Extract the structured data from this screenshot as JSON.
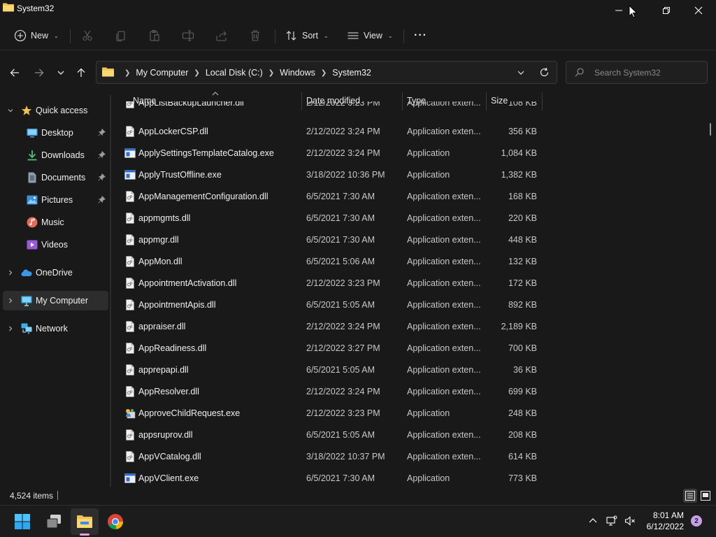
{
  "window": {
    "title": "System32"
  },
  "commandbar": {
    "new_label": "New",
    "sort_label": "Sort",
    "view_label": "View",
    "more_label": "···"
  },
  "address": {
    "crumbs": [
      "My Computer",
      "Local Disk (C:)",
      "Windows",
      "System32"
    ]
  },
  "search": {
    "placeholder": "Search System32"
  },
  "sidebar": {
    "items": [
      {
        "label": "Quick access",
        "icon": "star-icon"
      },
      {
        "label": "Desktop",
        "icon": "desktop-icon",
        "pinned": true
      },
      {
        "label": "Downloads",
        "icon": "download-icon",
        "pinned": true
      },
      {
        "label": "Documents",
        "icon": "document-icon",
        "pinned": true
      },
      {
        "label": "Pictures",
        "icon": "pictures-icon",
        "pinned": true
      },
      {
        "label": "Music",
        "icon": "music-icon"
      },
      {
        "label": "Videos",
        "icon": "video-icon"
      },
      {
        "label": "OneDrive",
        "icon": "cloud-icon"
      },
      {
        "label": "My Computer",
        "icon": "computer-icon",
        "selected": true
      },
      {
        "label": "Network",
        "icon": "network-icon"
      }
    ]
  },
  "filelist": {
    "columns": {
      "name": "Name",
      "date": "Date modified",
      "type": "Type",
      "size": "Size"
    },
    "partial_row": {
      "name": "AppListBackupLauncher.dll",
      "date": "2/12/2022 3:23 PM",
      "type": "Application exten...",
      "size": "108 KB"
    },
    "rows": [
      {
        "name": "AppLockerCSP.dll",
        "date": "2/12/2022 3:24 PM",
        "type": "Application exten...",
        "size": "356 KB",
        "kind": "dll"
      },
      {
        "name": "ApplySettingsTemplateCatalog.exe",
        "date": "2/12/2022 3:24 PM",
        "type": "Application",
        "size": "1,084 KB",
        "kind": "exe"
      },
      {
        "name": "ApplyTrustOffline.exe",
        "date": "3/18/2022 10:36 PM",
        "type": "Application",
        "size": "1,382 KB",
        "kind": "exe"
      },
      {
        "name": "AppManagementConfiguration.dll",
        "date": "6/5/2021 7:30 AM",
        "type": "Application exten...",
        "size": "168 KB",
        "kind": "dll"
      },
      {
        "name": "appmgmts.dll",
        "date": "6/5/2021 7:30 AM",
        "type": "Application exten...",
        "size": "220 KB",
        "kind": "dll"
      },
      {
        "name": "appmgr.dll",
        "date": "6/5/2021 7:30 AM",
        "type": "Application exten...",
        "size": "448 KB",
        "kind": "dll"
      },
      {
        "name": "AppMon.dll",
        "date": "6/5/2021 5:06 AM",
        "type": "Application exten...",
        "size": "132 KB",
        "kind": "dll"
      },
      {
        "name": "AppointmentActivation.dll",
        "date": "2/12/2022 3:23 PM",
        "type": "Application exten...",
        "size": "172 KB",
        "kind": "dll"
      },
      {
        "name": "AppointmentApis.dll",
        "date": "6/5/2021 5:05 AM",
        "type": "Application exten...",
        "size": "892 KB",
        "kind": "dll"
      },
      {
        "name": "appraiser.dll",
        "date": "2/12/2022 3:24 PM",
        "type": "Application exten...",
        "size": "2,189 KB",
        "kind": "dll"
      },
      {
        "name": "AppReadiness.dll",
        "date": "2/12/2022 3:27 PM",
        "type": "Application exten...",
        "size": "700 KB",
        "kind": "dll"
      },
      {
        "name": "apprepapi.dll",
        "date": "6/5/2021 5:05 AM",
        "type": "Application exten...",
        "size": "36 KB",
        "kind": "dll"
      },
      {
        "name": "AppResolver.dll",
        "date": "2/12/2022 3:24 PM",
        "type": "Application exten...",
        "size": "699 KB",
        "kind": "dll"
      },
      {
        "name": "ApproveChildRequest.exe",
        "date": "2/12/2022 3:23 PM",
        "type": "Application",
        "size": "248 KB",
        "kind": "exe-special"
      },
      {
        "name": "appsruprov.dll",
        "date": "6/5/2021 5:05 AM",
        "type": "Application exten...",
        "size": "208 KB",
        "kind": "dll"
      },
      {
        "name": "AppVCatalog.dll",
        "date": "3/18/2022 10:37 PM",
        "type": "Application exten...",
        "size": "614 KB",
        "kind": "dll"
      },
      {
        "name": "AppVClient.exe",
        "date": "6/5/2021 7:30 AM",
        "type": "Application",
        "size": "773 KB",
        "kind": "exe"
      }
    ]
  },
  "status": {
    "item_count": "4,524 items"
  },
  "taskbar": {
    "time": "8:01 AM",
    "date": "6/12/2022",
    "notification_count": "2"
  }
}
